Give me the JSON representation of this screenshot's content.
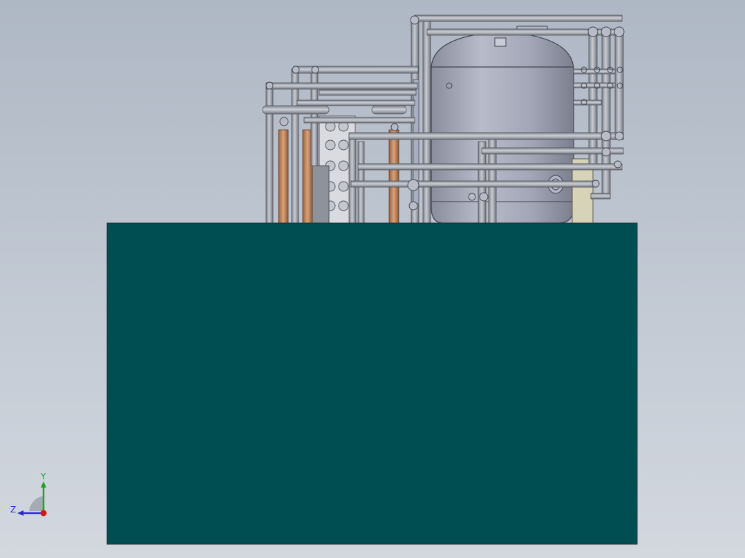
{
  "viewport": {
    "background_top": "#aeb7c4",
    "background_bottom": "#d3d8df"
  },
  "model": {
    "base_color": "#004e52",
    "tank_color": "#a6a9b8",
    "pipe_color": "#9a9ea7",
    "membrane_color": "#c88a5c"
  },
  "triad": {
    "y_label": "Y",
    "z_label": "Z",
    "y_color": "#1fa01f",
    "z_color": "#2a2ad0",
    "origin_color": "#d01818"
  }
}
